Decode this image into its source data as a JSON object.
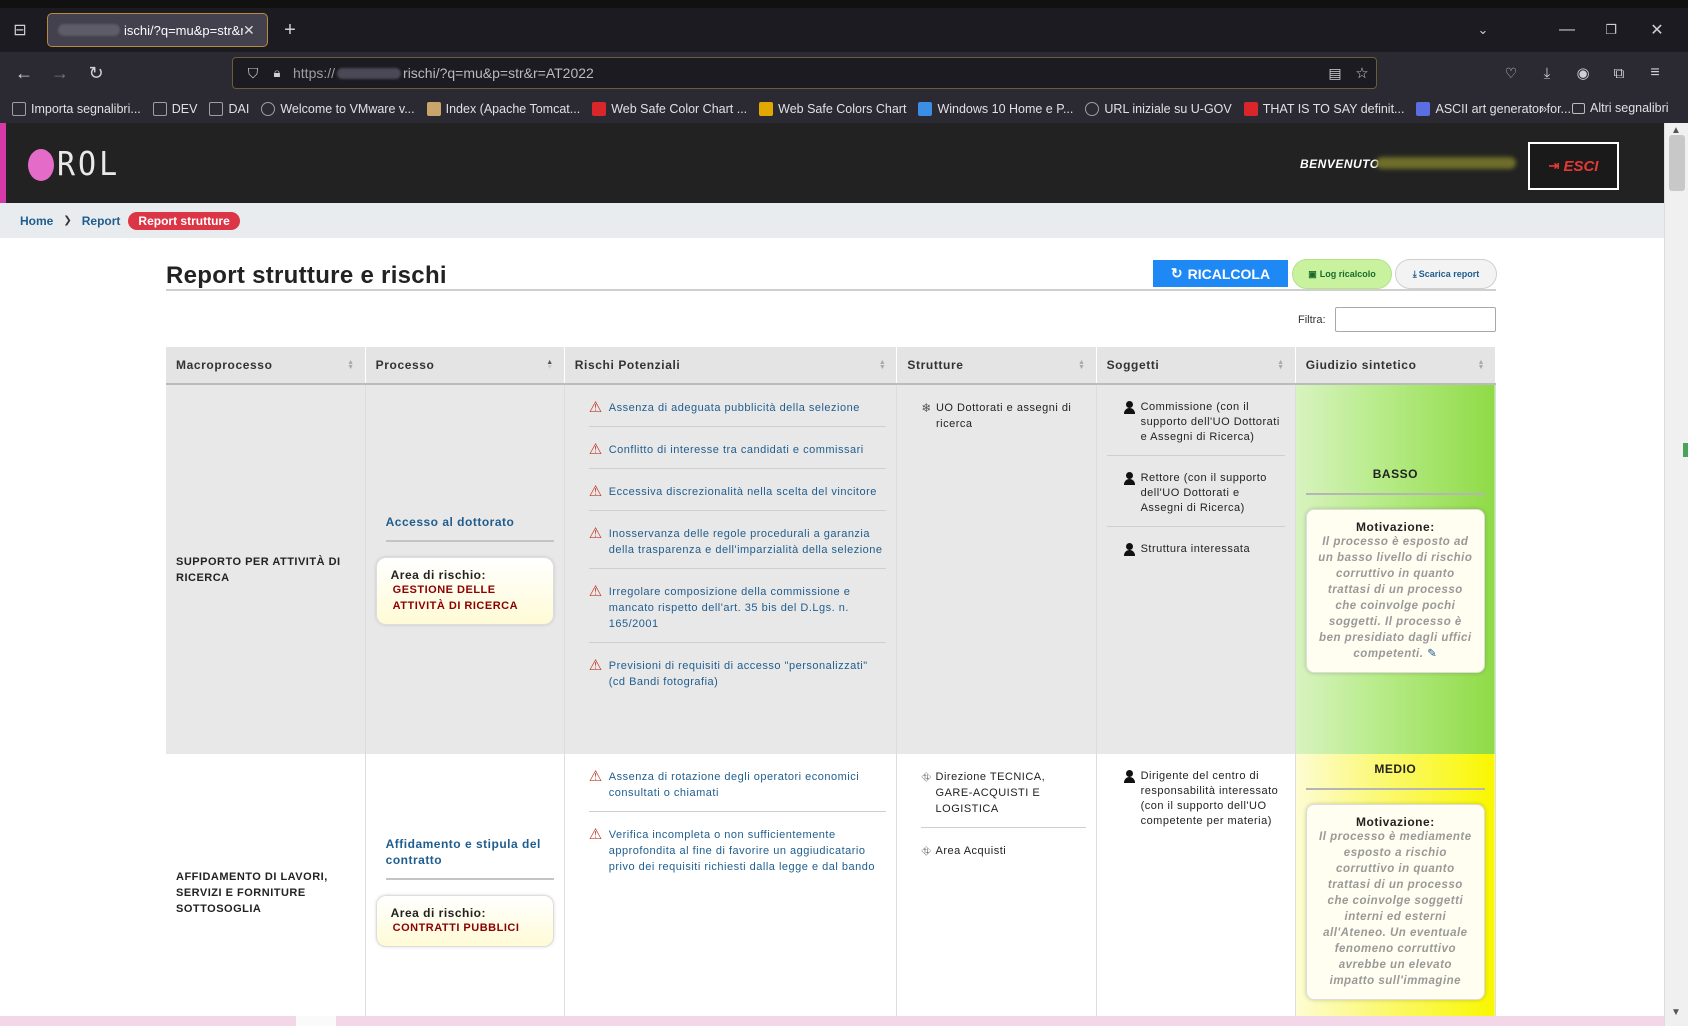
{
  "browser": {
    "tab_title": "ischi/?q=mu&p=str&r=",
    "url_scheme": "https://",
    "url_path": "rischi/?q=mu&p=str&r=AT2022",
    "bookmarks": [
      {
        "label": "Importa segnalibri...",
        "icon": "import-icon",
        "color": "#9e9ea6"
      },
      {
        "label": "DEV",
        "icon": "folder-icon",
        "color": "#9e9ea6"
      },
      {
        "label": "DAI",
        "icon": "folder-icon",
        "color": "#9e9ea6"
      },
      {
        "label": "Welcome to VMware v...",
        "icon": "globe-icon",
        "color": "#9e9ea6"
      },
      {
        "label": "Index (Apache Tomcat...",
        "icon": "image-icon",
        "color": "#c9a46b"
      },
      {
        "label": "Web Safe Color Chart ...",
        "icon": "color-chart-icon",
        "color": "#d9262b"
      },
      {
        "label": "Web Safe Colors Chart",
        "icon": "r-logo-icon",
        "color": "#e0a800"
      },
      {
        "label": "Windows 10 Home e P...",
        "icon": "windows-icon",
        "color": "#3a8ee6"
      },
      {
        "label": "URL iniziale su U-GOV",
        "icon": "globe-icon",
        "color": "#9e9ea6"
      },
      {
        "label": "THAT IS TO SAY definit...",
        "icon": "c-logo-icon",
        "color": "#d9262b"
      },
      {
        "label": "ASCII art generator for...",
        "icon": "ascii-icon",
        "color": "#5a6ee0"
      }
    ],
    "other_bookmarks": "Altri segnalibri"
  },
  "app": {
    "logo_text": "ROL",
    "welcome": "BENVENUTO",
    "logout_label": "ESCI"
  },
  "breadcrumb": {
    "home": "Home",
    "report": "Report",
    "active": "Report strutture"
  },
  "page": {
    "title": "Report strutture e rischi",
    "ricalcola_label": "RICALCOLA",
    "log_label": "Log ricalcolo",
    "scarica_label": "Scarica report",
    "filter_label": "Filtra:",
    "filter_value": ""
  },
  "table": {
    "headers": [
      "Macroprocesso",
      "Processo",
      "Rischi Potenziali",
      "Strutture",
      "Soggetti",
      "Giudizio sintetico"
    ],
    "rows": [
      {
        "macroprocesso": "SUPPORTO PER ATTIVITÀ DI RICERCA",
        "processo": "Accesso al dottorato",
        "area_label": "Area di rischio:",
        "area_value": "GESTIONE DELLE ATTIVITÀ DI RICERCA",
        "rischi": [
          "Assenza di adeguata pubblicità della selezione",
          "Conflitto di interesse tra candidati e commissari",
          "Eccessiva discrezionalità nella scelta del vincitore",
          "Inosservanza delle regole procedurali a garanzia della trasparenza e dell'imparzialità della selezione",
          "Irregolare composizione della commissione e mancato rispetto dell'art. 35 bis del D.Lgs. n. 165/2001",
          "Previsioni di requisiti di accesso \"personalizzati\" (cd Bandi fotografia)"
        ],
        "strutture": [
          "UO Dottorati e assegni di ricerca"
        ],
        "soggetti": [
          "Commissione (con il supporto dell'UO Dottorati e Assegni di Ricerca)",
          "Rettore (con il supporto dell'UO Dottorati e Assegni di Ricerca)",
          "Struttura interessata"
        ],
        "giudizio": "BASSO",
        "motivazione_label": "Motivazione:",
        "motivazione": "Il processo è esposto ad un basso livello di rischio corruttivo in quanto trattasi di un processo che coinvolge pochi soggetti. Il processo è ben presidiato dagli uffici competenti."
      },
      {
        "macroprocesso": "AFFIDAMENTO DI LAVORI, SERVIZI E FORNITURE SOTTOSOGLIA",
        "processo": "Affidamento e stipula del contratto",
        "area_label": "Area di rischio:",
        "area_value": "CONTRATTI PUBBLICI",
        "rischi": [
          "Assenza di rotazione degli operatori economici consultati o chiamati",
          "Verifica incompleta o non sufficientemente approfondita al fine di favorire un aggiudicatario privo dei requisiti richiesti dalla legge e dal bando"
        ],
        "strutture": [
          "Direzione TECNICA, GARE-ACQUISTI E LOGISTICA",
          "Area Acquisti"
        ],
        "soggetti": [
          "Dirigente del centro di responsabilità interessato (con il supporto dell'UO competente per materia)"
        ],
        "giudizio": "MEDIO",
        "motivazione_label": "Motivazione:",
        "motivazione": "Il processo è mediamente esposto a rischio corruttivo in quanto trattasi di un processo che coinvolge soggetti interni ed esterni all'Ateneo. Un eventuale fenomeno corruttivo avrebbe un elevato impatto sull'immagine"
      }
    ]
  },
  "colors": {
    "accent_pink": "#d63aa8",
    "logout_red": "#e53935",
    "primary_blue": "#1e88f5",
    "link_blue": "#1f5d8e",
    "giudizio_basso": "#8fdb46",
    "giudizio_medio": "#f9f700"
  }
}
